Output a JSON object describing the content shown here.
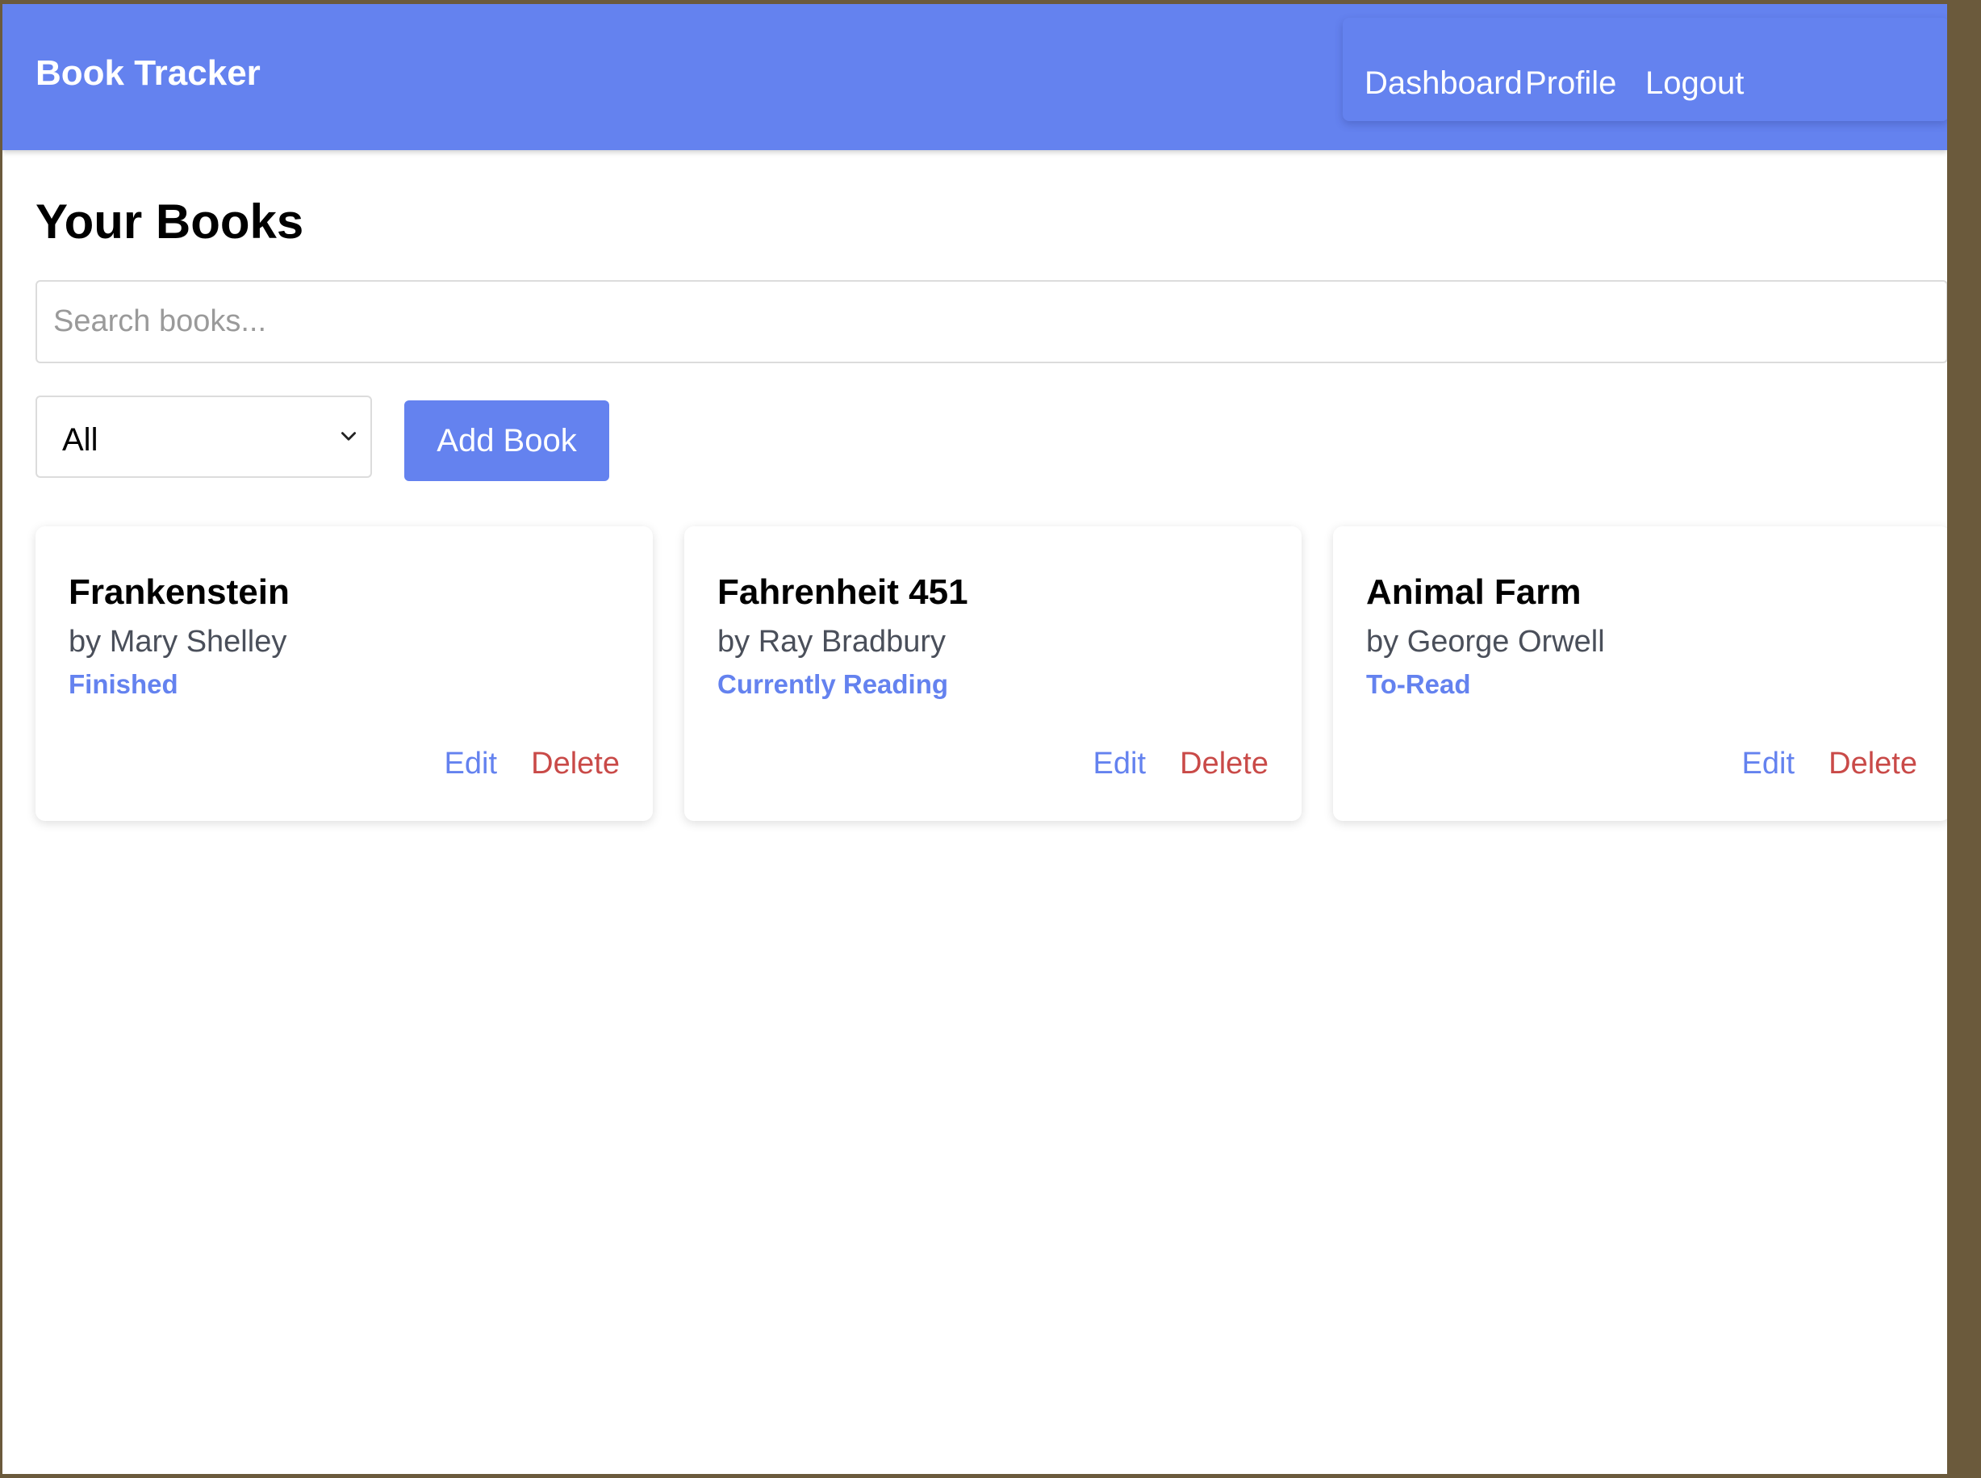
{
  "navbar": {
    "brand": "Book Tracker",
    "links": {
      "dashboard": "Dashboard",
      "profile": "Profile",
      "logout": "Logout"
    }
  },
  "main": {
    "title": "Your Books",
    "search": {
      "placeholder": "Search books...",
      "value": ""
    },
    "filter": {
      "selected": "All"
    },
    "add_button_label": "Add Book",
    "books": [
      {
        "title": "Frankenstein",
        "author": "by Mary Shelley",
        "status": "Finished",
        "edit_label": "Edit",
        "delete_label": "Delete"
      },
      {
        "title": "Fahrenheit 451",
        "author": "by Ray Bradbury",
        "status": "Currently Reading",
        "edit_label": "Edit",
        "delete_label": "Delete"
      },
      {
        "title": "Animal Farm",
        "author": "by George Orwell",
        "status": "To-Read",
        "edit_label": "Edit",
        "delete_label": "Delete"
      }
    ]
  },
  "colors": {
    "primary": "#6482ef",
    "danger": "#c94a48",
    "muted_text": "#4a4f5a"
  },
  "icons": {
    "filter_dropdown": "chevron-down-icon"
  }
}
